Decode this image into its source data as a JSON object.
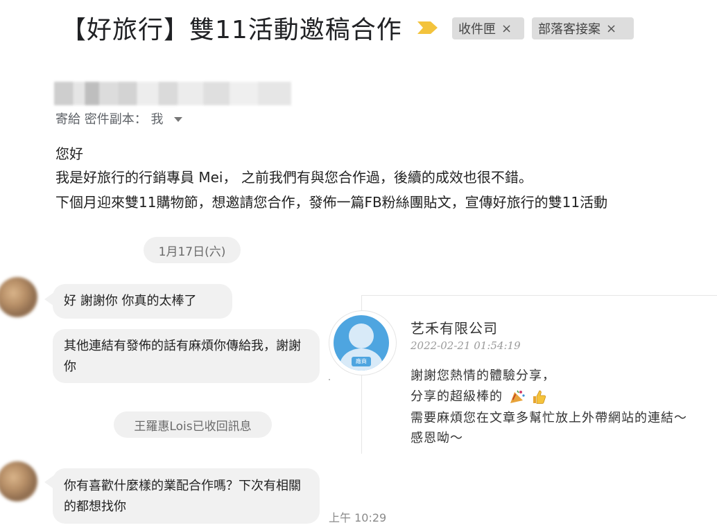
{
  "email": {
    "subject": "【好旅行】雙11活動邀稿合作",
    "labels": [
      {
        "name": "收件匣",
        "close": "×"
      },
      {
        "name": "部落客接案",
        "close": "×"
      }
    ],
    "recipients_text": "寄給 密件副本： 我",
    "body_lines": [
      "您好",
      "我是好旅行的行銷專員 Mei， 之前我們有與您合作過，後續的成效也很不錯。",
      "下個月迎來雙11購物節，想邀請您合作，發佈一篇FB粉絲團貼文，宣傳好旅行的雙11活動"
    ]
  },
  "chat": {
    "date": "1月17日(六)",
    "messages": [
      "好 謝謝你 你真的太棒了",
      "其他連結有發佈的話有麻煩你傳給我，謝謝你",
      "你有喜歡什麼樣的業配合作嗎？下次有相關的都想找你"
    ],
    "recall_notice": "王羅惠Lois已收回訊息",
    "timestamp": "上午 10:29"
  },
  "comment": {
    "avatar_tag": "廠商",
    "company": "艺禾有限公司",
    "datetime": "2022-02-21 01:54:19",
    "lines": [
      "謝謝您熱情的體驗分享，",
      "分享的超級棒的",
      "需要麻煩您在文章多幫忙放上外帶網站的連結～",
      "感恩呦～"
    ],
    "emojis": [
      "party-popper-icon",
      "thumbs-up-icon"
    ]
  },
  "colors": {
    "importance_marker": "#f3c33c",
    "chip_bg": "#dddddd",
    "bubble_bg": "#f1f1f1",
    "avatar_blue": "#4ea5e0"
  }
}
